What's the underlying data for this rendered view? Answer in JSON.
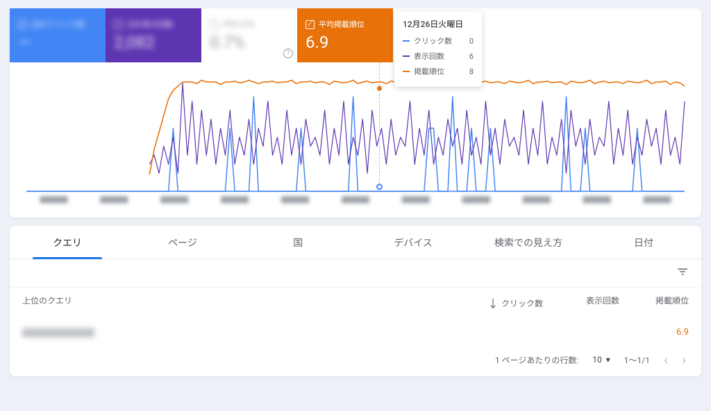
{
  "metrics": {
    "clicks": {
      "label": "合計クリック数",
      "value": "—"
    },
    "impressions": {
      "label": "合計表示回数",
      "value": "2,082"
    },
    "ctr": {
      "label": "平均 CTR",
      "value": "0.7%"
    },
    "position": {
      "label": "平均掲載順位",
      "value": "6.9"
    }
  },
  "tooltip": {
    "date": "12月26日火曜日",
    "rows": {
      "clicks": {
        "label": "クリック数",
        "value": "0"
      },
      "impressions": {
        "label": "表示回数",
        "value": "6"
      },
      "position": {
        "label": "掲載順位",
        "value": "8"
      }
    }
  },
  "xaxis_ticks": [
    "",
    "",
    "",
    "",
    "",
    "",
    "",
    "",
    "",
    "",
    ""
  ],
  "tabs": {
    "query": "クエリ",
    "page": "ページ",
    "country": "国",
    "device": "デバイス",
    "appearance": "検索での見え方",
    "date": "日付"
  },
  "table": {
    "headers": {
      "query": "上位のクエリ",
      "clicks": "クリック数",
      "impressions": "表示回数",
      "position": "掲載順位"
    },
    "rows": [
      {
        "query": "████████",
        "clicks": "",
        "impressions": "",
        "position": "6.9"
      }
    ]
  },
  "pagination": {
    "rows_label": "1 ページあたりの行数:",
    "rows_value": "10",
    "range": "1～1/1"
  },
  "chart_data": {
    "type": "line",
    "x_count": 140,
    "series": [
      {
        "name": "クリック数",
        "color": "#4285f4",
        "values": [
          0,
          0,
          0,
          0,
          0,
          0,
          0,
          0,
          0,
          0,
          0,
          0,
          0,
          0,
          0,
          0,
          0,
          0,
          0,
          0,
          0,
          0,
          0,
          0,
          0,
          0,
          0,
          0,
          0,
          0,
          0,
          2,
          0,
          0,
          0,
          0,
          0,
          0,
          0,
          0,
          0,
          0,
          0,
          2,
          0,
          0,
          0,
          0,
          3,
          0,
          0,
          0,
          0,
          0,
          0,
          0,
          0,
          0,
          2,
          0,
          0,
          0,
          0,
          0,
          0,
          0,
          0,
          0,
          0,
          3,
          0,
          0,
          0,
          0,
          0,
          0,
          0,
          0,
          0,
          0,
          0,
          0,
          0,
          0,
          0,
          2,
          2,
          0,
          0,
          0,
          3,
          0,
          0,
          0,
          2,
          0,
          0,
          0,
          2,
          0,
          0,
          0,
          0,
          0,
          0,
          0,
          0,
          0,
          0,
          0,
          0,
          0,
          0,
          0,
          3,
          0,
          0,
          0,
          2,
          0,
          0,
          0,
          0,
          0,
          0,
          0,
          0,
          0,
          0,
          2,
          0,
          0,
          0,
          0,
          0,
          0,
          0,
          0,
          0,
          0
        ]
      },
      {
        "name": "表示回数",
        "color": "#5e35b1",
        "values": [
          null,
          null,
          null,
          null,
          null,
          null,
          null,
          null,
          null,
          null,
          null,
          null,
          null,
          null,
          null,
          null,
          null,
          null,
          null,
          null,
          null,
          null,
          null,
          null,
          null,
          null,
          3,
          4,
          2,
          5,
          3,
          6,
          2,
          12,
          4,
          10,
          3,
          9,
          4,
          8,
          3,
          7,
          4,
          9,
          3,
          6,
          4,
          8,
          3,
          7,
          5,
          10,
          4,
          6,
          3,
          9,
          4,
          7,
          3,
          8,
          5,
          6,
          4,
          9,
          3,
          7,
          4,
          10,
          3,
          6,
          4,
          8,
          2,
          9,
          5,
          7,
          3,
          8,
          4,
          6,
          5,
          10,
          3,
          7,
          4,
          9,
          3,
          6,
          4,
          8,
          5,
          7,
          3,
          9,
          4,
          6,
          3,
          10,
          4,
          7,
          3,
          8,
          5,
          6,
          4,
          9,
          3,
          7,
          4,
          10,
          3,
          6,
          4,
          8,
          2,
          9,
          5,
          7,
          3,
          8,
          4,
          6,
          5,
          10,
          3,
          7,
          4,
          9,
          3,
          6,
          4,
          8,
          5,
          7,
          3,
          9,
          4,
          6,
          3,
          10
        ]
      },
      {
        "name": "掲載順位",
        "color": "#e8710a",
        "inverted": true,
        "values": [
          null,
          null,
          null,
          null,
          null,
          null,
          null,
          null,
          null,
          null,
          null,
          null,
          null,
          null,
          null,
          null,
          null,
          null,
          null,
          null,
          null,
          null,
          null,
          null,
          null,
          null,
          18,
          15,
          13,
          11,
          9,
          8,
          7.5,
          7,
          7,
          7,
          7.2,
          6.8,
          7,
          7,
          7,
          7.3,
          7,
          7,
          6.9,
          7.1,
          7,
          6.8,
          7,
          7.2,
          7,
          7,
          6.9,
          7.1,
          7,
          7,
          6.8,
          7.2,
          7,
          7,
          6.9,
          7.1,
          7,
          7,
          7.3,
          6.9,
          7,
          7.1,
          7,
          6.8,
          7.2,
          7,
          6.9,
          7.1,
          7,
          7,
          7.2,
          6.9,
          7,
          7.1,
          7,
          6.8,
          7.2,
          7,
          7,
          6.9,
          7.1,
          7,
          7,
          7.3,
          6.9,
          7,
          7.1,
          7,
          6.8,
          7.2,
          7,
          6.9,
          7.1,
          7,
          7,
          7.2,
          6.9,
          7,
          7.1,
          7,
          6.8,
          7.2,
          7,
          7,
          6.9,
          7.1,
          7,
          7,
          7.3,
          6.9,
          7,
          7.1,
          7,
          6.8,
          7.2,
          7,
          6.9,
          7.1,
          7,
          7,
          7.2,
          6.9,
          7,
          7.1,
          7,
          6.8,
          7.2,
          7,
          7,
          6.9,
          7.3,
          7,
          7.1,
          7.5
        ]
      }
    ],
    "ylim_clicks": [
      0,
      4
    ],
    "ylim_impr": [
      0,
      14
    ],
    "ylim_pos": [
      20,
      5
    ]
  }
}
